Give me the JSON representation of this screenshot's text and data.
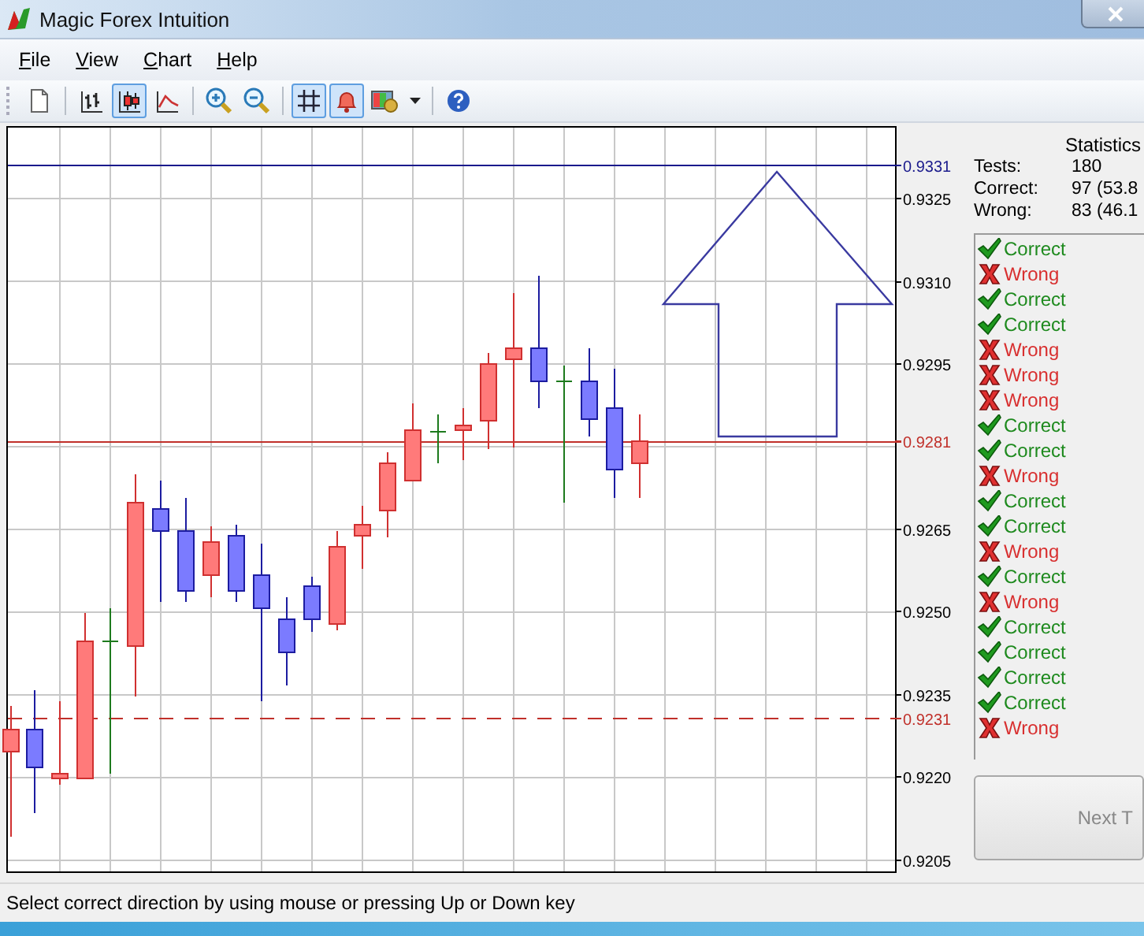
{
  "window": {
    "title": "Magic Forex Intuition"
  },
  "menu": [
    "File",
    "View",
    "Chart",
    "Help"
  ],
  "toolbar": [
    [
      {
        "kind": "new",
        "selected": false
      }
    ],
    [
      {
        "kind": "bars",
        "selected": false
      },
      {
        "kind": "candles",
        "selected": true
      },
      {
        "kind": "line",
        "selected": false
      }
    ],
    [
      {
        "kind": "zoom-in",
        "selected": false
      },
      {
        "kind": "zoom-out",
        "selected": false
      }
    ],
    [
      {
        "kind": "grid",
        "selected": true
      },
      {
        "kind": "bell",
        "selected": true
      },
      {
        "kind": "colors",
        "selected": false
      },
      {
        "kind": "caret",
        "selected": false
      }
    ],
    [
      {
        "kind": "help",
        "selected": false
      }
    ]
  ],
  "price_axis": [
    {
      "text": "0.9331",
      "color": "#1a1a8c"
    },
    {
      "text": "0.9325",
      "color": "#000000"
    },
    {
      "text": "0.9310",
      "color": "#000000"
    },
    {
      "text": "0.9295",
      "color": "#000000"
    },
    {
      "text": "0.9281",
      "color": "#c0302a"
    },
    {
      "text": "0.9265",
      "color": "#000000"
    },
    {
      "text": "0.9250",
      "color": "#000000"
    },
    {
      "text": "0.9235",
      "color": "#000000"
    },
    {
      "text": "0.9231",
      "color": "#c0302a"
    },
    {
      "text": "0.9220",
      "color": "#000000"
    },
    {
      "text": "0.9205",
      "color": "#000000"
    }
  ],
  "statistics": {
    "title": "Statistics",
    "rows": [
      {
        "label": "Tests:",
        "value": "180"
      },
      {
        "label": "Correct:",
        "value": "97 (53.8"
      },
      {
        "label": "Wrong:",
        "value": "83 (46.1"
      }
    ]
  },
  "results": [
    {
      "kind": "correct",
      "label": "Correct"
    },
    {
      "kind": "wrong",
      "label": "Wrong"
    },
    {
      "kind": "correct",
      "label": "Correct"
    },
    {
      "kind": "correct",
      "label": "Correct"
    },
    {
      "kind": "wrong",
      "label": "Wrong"
    },
    {
      "kind": "wrong",
      "label": "Wrong"
    },
    {
      "kind": "wrong",
      "label": "Wrong"
    },
    {
      "kind": "correct",
      "label": "Correct"
    },
    {
      "kind": "correct",
      "label": "Correct"
    },
    {
      "kind": "wrong",
      "label": "Wrong"
    },
    {
      "kind": "correct",
      "label": "Correct"
    },
    {
      "kind": "correct",
      "label": "Correct"
    },
    {
      "kind": "wrong",
      "label": "Wrong"
    },
    {
      "kind": "correct",
      "label": "Correct"
    },
    {
      "kind": "wrong",
      "label": "Wrong"
    },
    {
      "kind": "correct",
      "label": "Correct"
    },
    {
      "kind": "correct",
      "label": "Correct"
    },
    {
      "kind": "correct",
      "label": "Correct"
    },
    {
      "kind": "correct",
      "label": "Correct"
    },
    {
      "kind": "wrong",
      "label": "Wrong"
    }
  ],
  "next_button": "Next T",
  "status_bar": "Select correct direction by using mouse or pressing Up or Down key"
}
